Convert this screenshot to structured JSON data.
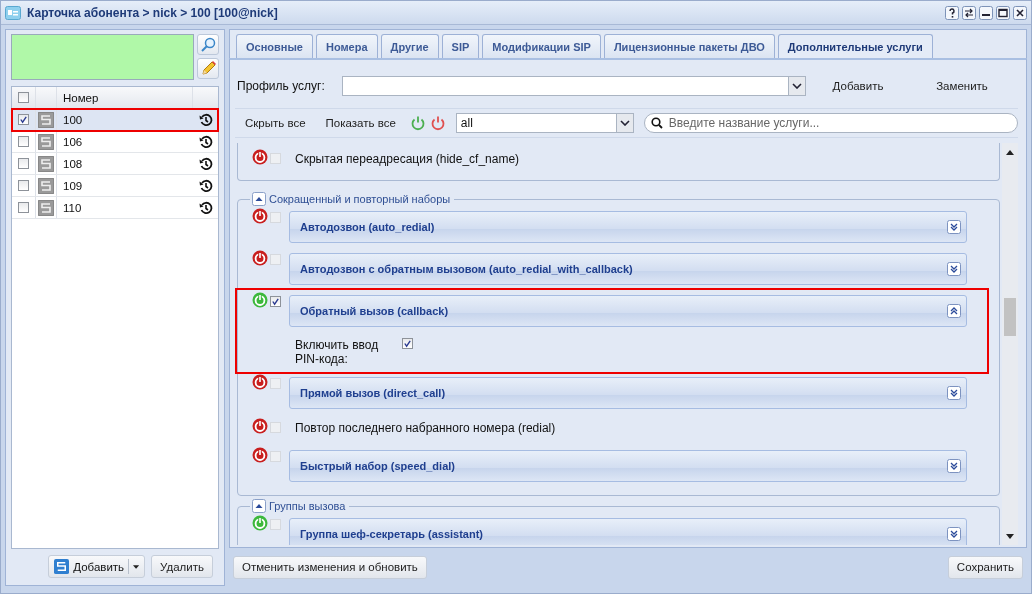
{
  "window": {
    "title": "Карточка абонента > nick > 100 [100@nick]"
  },
  "left": {
    "table": {
      "columns": [
        "Номер"
      ],
      "header_checked": false,
      "rows": [
        {
          "number": "100",
          "checked": true,
          "selected": true,
          "highlighted": true
        },
        {
          "number": "106",
          "checked": false,
          "selected": false,
          "highlighted": false
        },
        {
          "number": "108",
          "checked": false,
          "selected": false,
          "highlighted": false
        },
        {
          "number": "109",
          "checked": false,
          "selected": false,
          "highlighted": false
        },
        {
          "number": "110",
          "checked": false,
          "selected": false,
          "highlighted": false
        }
      ]
    },
    "add_button": "Добавить",
    "delete_button": "Удалить"
  },
  "tabs": [
    {
      "label": "Основные",
      "selected": false
    },
    {
      "label": "Номера",
      "selected": false
    },
    {
      "label": "Другие",
      "selected": false
    },
    {
      "label": "SIP",
      "selected": false
    },
    {
      "label": "Модификации SIP",
      "selected": false
    },
    {
      "label": "Лицензионные пакеты ДВО",
      "selected": false
    },
    {
      "label": "Дополнительные услуги",
      "selected": true
    }
  ],
  "profile": {
    "label": "Профиль услуг:",
    "add": "Добавить",
    "replace": "Заменить"
  },
  "toolbar": {
    "hide_all": "Скрыть все",
    "show_all": "Показать все",
    "filter": "all",
    "search_placeholder": "Введите название услуги..."
  },
  "groups": [
    {
      "services": [
        {
          "kind": "plain",
          "name": "Скрытая переадресация (hide_cf_name)",
          "on": false,
          "checked": false
        }
      ]
    },
    {
      "title": "Сокращенный и повторный наборы",
      "expanded": true,
      "services": [
        {
          "kind": "panel",
          "name": "Автодозвон (auto_redial)",
          "on": false,
          "checked": false,
          "expanded": false
        },
        {
          "kind": "panel",
          "name": "Автодозвон с обратным вызовом (auto_redial_with_callback)",
          "on": false,
          "checked": false,
          "expanded": false
        },
        {
          "kind": "panel",
          "name": "Обратный вызов (callback)",
          "on": true,
          "checked": true,
          "expanded": true,
          "highlighted": true,
          "options": [
            {
              "label": "Включить ввод PIN-кода:",
              "checked": true
            }
          ]
        },
        {
          "kind": "panel",
          "name": "Прямой вызов (direct_call)",
          "on": false,
          "checked": false,
          "expanded": false
        },
        {
          "kind": "plain",
          "name": "Повтор последнего набранного номера (redial)",
          "on": false,
          "checked": false
        },
        {
          "kind": "panel",
          "name": "Быстрый набор (speed_dial)",
          "on": false,
          "checked": false,
          "expanded": false
        }
      ]
    },
    {
      "title": "Группы вызова",
      "expanded": true,
      "services": [
        {
          "kind": "panel",
          "name": "Группа шеф-секретарь (assistant)",
          "on": true,
          "checked": false,
          "expanded": false
        }
      ]
    }
  ],
  "footer": {
    "cancel": "Отменить изменения и обновить",
    "save": "Сохранить"
  }
}
